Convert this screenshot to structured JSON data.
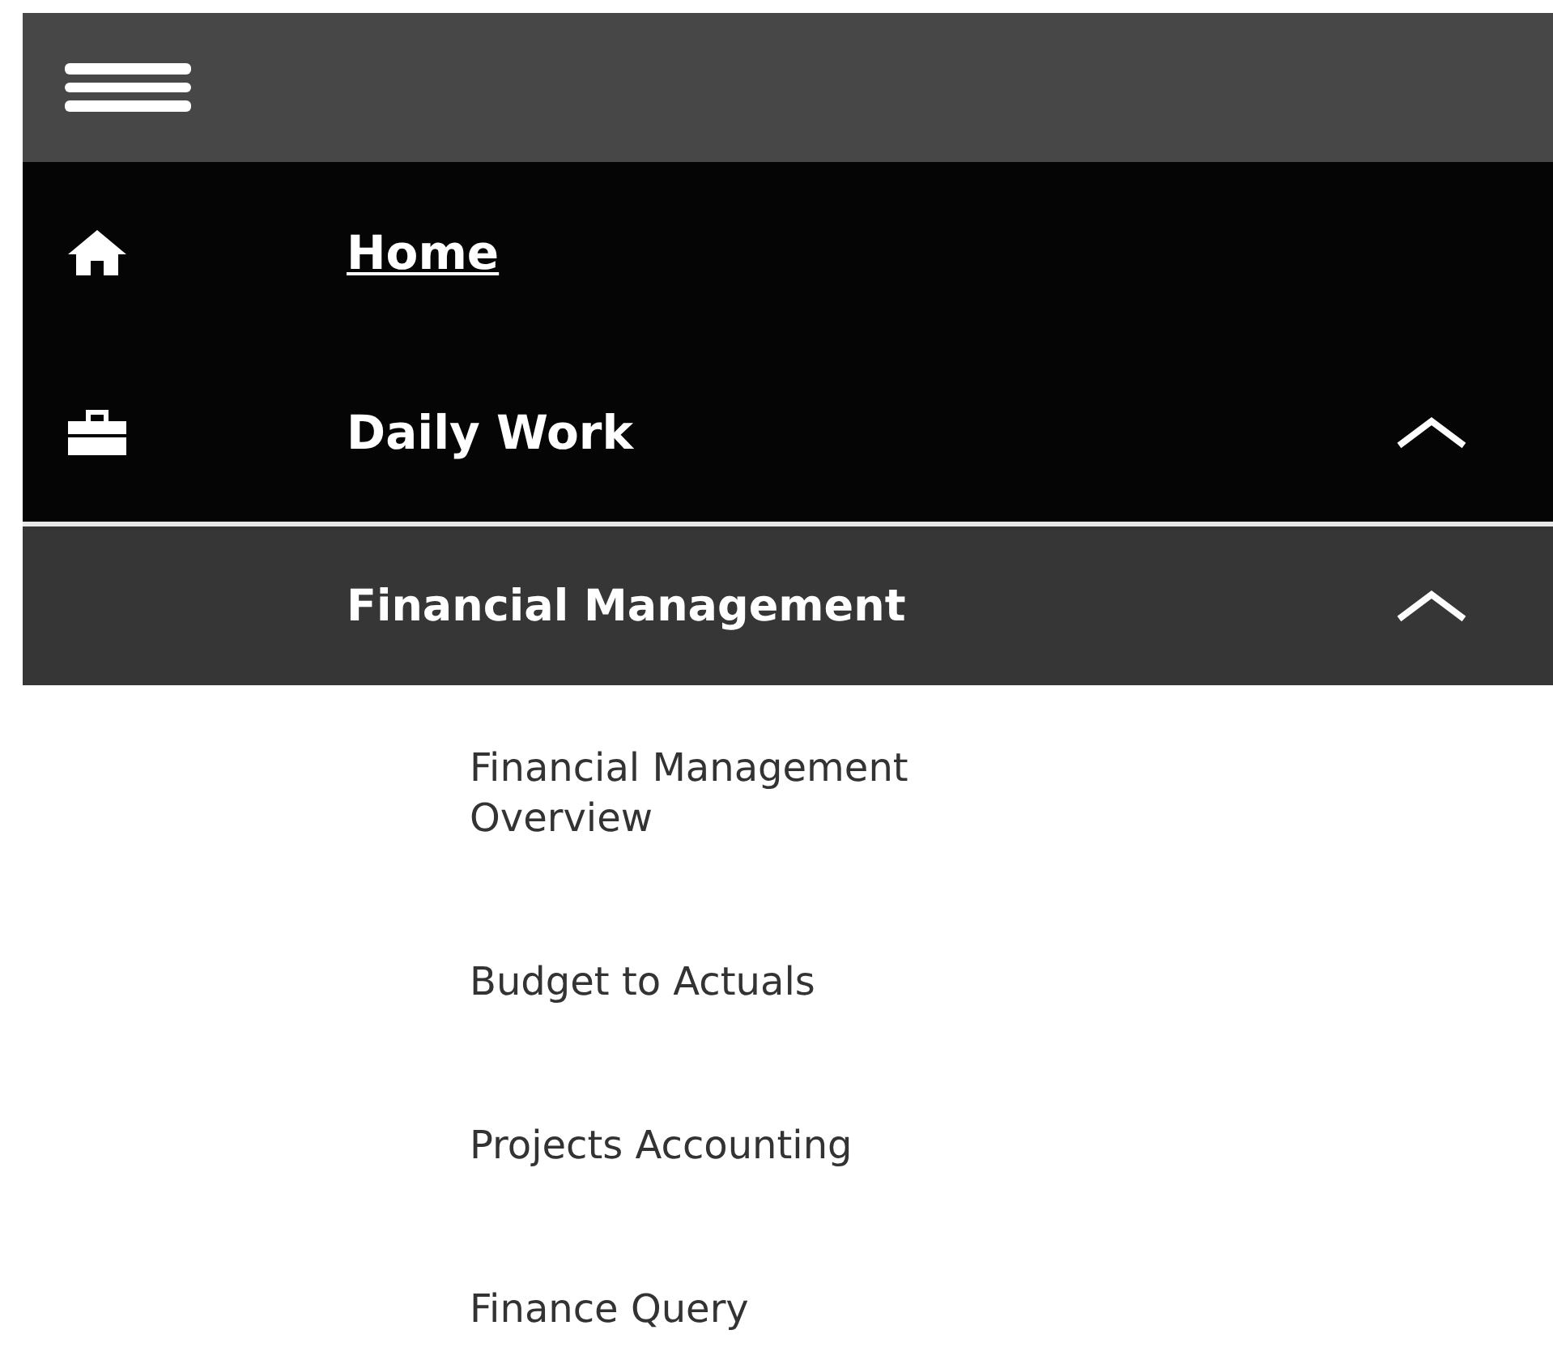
{
  "nav": [
    {
      "kind": "link",
      "label": "Home"
    },
    {
      "kind": "group",
      "label": "Daily Work",
      "expanded": true
    }
  ],
  "submenu": {
    "label": "Financial Management",
    "expanded": true,
    "items": [
      {
        "label": "Financial Management Overview"
      },
      {
        "label": "Budget to Actuals"
      },
      {
        "label": "Projects Accounting"
      },
      {
        "label": "Finance Query"
      }
    ]
  }
}
